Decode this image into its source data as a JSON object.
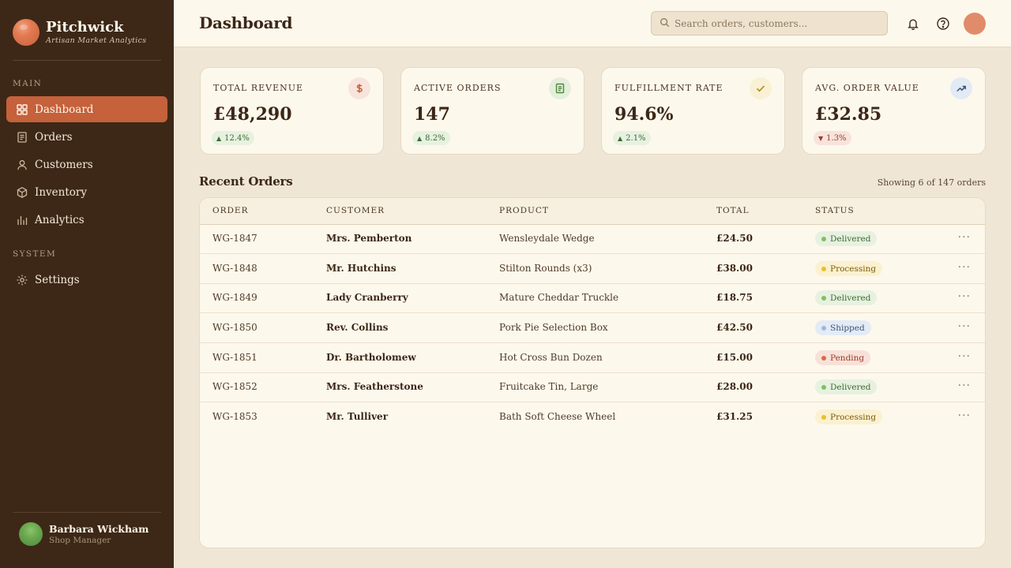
{
  "brand": {
    "name": "Pitchwick",
    "tagline": "Artisan Market Analytics"
  },
  "sidebar": {
    "section_main": "MAIN",
    "section_system": "SYSTEM",
    "items": [
      {
        "label": "Dashboard",
        "icon": "grid-icon",
        "active": true
      },
      {
        "label": "Orders",
        "icon": "receipt-icon"
      },
      {
        "label": "Customers",
        "icon": "user-icon"
      },
      {
        "label": "Inventory",
        "icon": "box-icon"
      },
      {
        "label": "Analytics",
        "icon": "bar-chart-icon"
      }
    ],
    "system_items": [
      {
        "label": "Settings",
        "icon": "gear-icon"
      }
    ],
    "user": {
      "name": "Barbara Wickham",
      "role": "Shop Manager"
    }
  },
  "header": {
    "title": "Dashboard",
    "search_placeholder": "Search orders, customers..."
  },
  "cards": [
    {
      "label": "TOTAL REVENUE",
      "value": "£48,290",
      "delta": "12.4%",
      "direction": "up",
      "icon": "dollar-icon"
    },
    {
      "label": "ACTIVE ORDERS",
      "value": "147",
      "delta": "8.2%",
      "direction": "up",
      "icon": "document-icon"
    },
    {
      "label": "FULFILLMENT RATE",
      "value": "94.6%",
      "delta": "2.1%",
      "direction": "up",
      "icon": "check-icon"
    },
    {
      "label": "AVG. ORDER VALUE",
      "value": "£32.85",
      "delta": "1.3%",
      "direction": "down",
      "icon": "trend-up-icon"
    }
  ],
  "recent_orders": {
    "title": "Recent Orders",
    "meta": "Showing 6 of 147 orders",
    "columns": [
      "ORDER",
      "CUSTOMER",
      "PRODUCT",
      "TOTAL",
      "STATUS"
    ],
    "rows": [
      {
        "order": "WG-1847",
        "customer": "Mrs. Pemberton",
        "product": "Wensleydale Wedge",
        "total": "£24.50",
        "status": "Delivered"
      },
      {
        "order": "WG-1848",
        "customer": "Mr. Hutchins",
        "product": "Stilton Rounds (x3)",
        "total": "£38.00",
        "status": "Processing"
      },
      {
        "order": "WG-1849",
        "customer": "Lady Cranberry",
        "product": "Mature Cheddar Truckle",
        "total": "£18.75",
        "status": "Delivered"
      },
      {
        "order": "WG-1850",
        "customer": "Rev. Collins",
        "product": "Pork Pie Selection Box",
        "total": "£42.50",
        "status": "Shipped"
      },
      {
        "order": "WG-1851",
        "customer": "Dr. Bartholomew",
        "product": "Hot Cross Bun Dozen",
        "total": "£15.00",
        "status": "Pending"
      },
      {
        "order": "WG-1852",
        "customer": "Mrs. Featherstone",
        "product": "Fruitcake Tin, Large",
        "total": "£28.00",
        "status": "Delivered"
      },
      {
        "order": "WG-1853",
        "customer": "Mr. Tulliver",
        "product": "Bath Soft Cheese Wheel",
        "total": "£31.25",
        "status": "Processing"
      }
    ]
  },
  "colors": {
    "sidebar": "#3d2818",
    "accent": "#c5613b",
    "background": "#efe6d6",
    "surface": "#fdf8ec"
  }
}
